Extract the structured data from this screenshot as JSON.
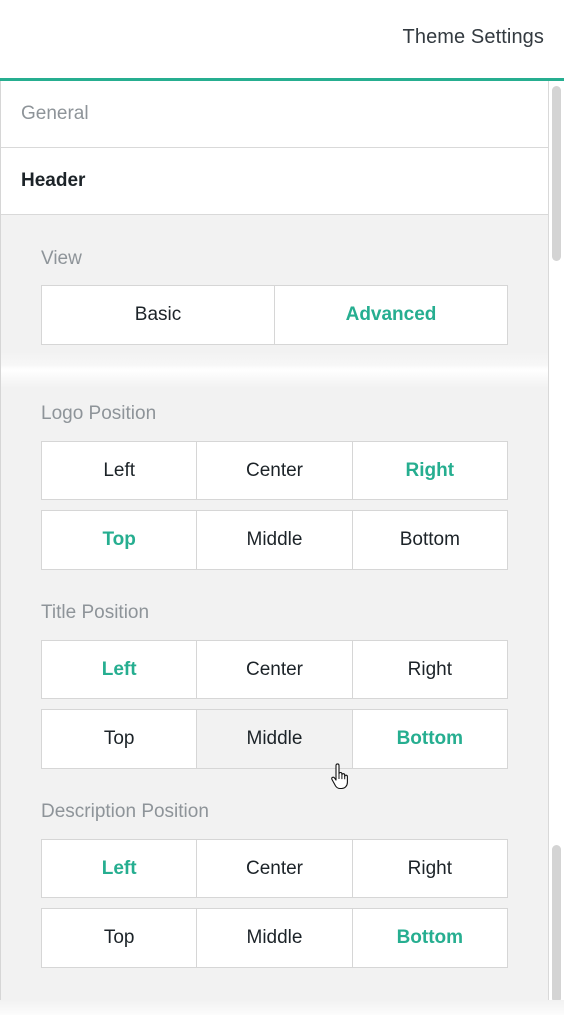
{
  "header": {
    "title": "Theme Settings"
  },
  "nav": {
    "items": [
      {
        "label": "General",
        "active": false
      },
      {
        "label": "Header",
        "active": true
      }
    ]
  },
  "colors": {
    "accent": "#26ae90",
    "label": "#8e9499",
    "text": "#1c2328",
    "panel_bg": "#f2f2f2",
    "border": "#d6d6d6"
  },
  "view": {
    "label": "View",
    "options": [
      "Basic",
      "Advanced"
    ],
    "selected": "Advanced"
  },
  "logo_position": {
    "label": "Logo Position",
    "horizontal": {
      "options": [
        "Left",
        "Center",
        "Right"
      ],
      "selected": "Right"
    },
    "vertical": {
      "options": [
        "Top",
        "Middle",
        "Bottom"
      ],
      "selected": "Top"
    }
  },
  "title_position": {
    "label": "Title Position",
    "horizontal": {
      "options": [
        "Left",
        "Center",
        "Right"
      ],
      "selected": "Left"
    },
    "vertical": {
      "options": [
        "Top",
        "Middle",
        "Bottom"
      ],
      "selected": "Bottom",
      "hovered": "Middle"
    }
  },
  "description_position": {
    "label": "Description Position",
    "horizontal": {
      "options": [
        "Left",
        "Center",
        "Right"
      ],
      "selected": "Left"
    },
    "vertical": {
      "options": [
        "Top",
        "Middle",
        "Bottom"
      ],
      "selected": "Bottom"
    }
  },
  "cursor": {
    "icon": "hand-pointer-icon"
  }
}
